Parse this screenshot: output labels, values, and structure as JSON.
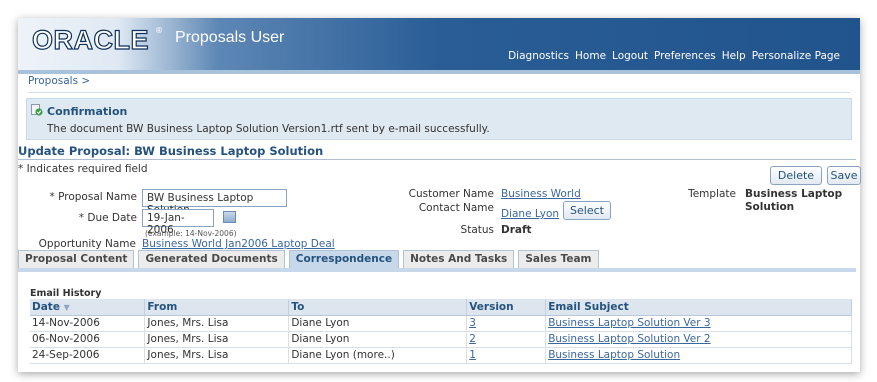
{
  "header": {
    "logo": "ORACLE",
    "logo_tm": "®",
    "app_title": "Proposals User",
    "global_links": [
      "Diagnostics",
      "Home",
      "Logout",
      "Preferences",
      "Help",
      "Personalize Page"
    ]
  },
  "breadcrumb": "Proposals  >",
  "confirmation": {
    "title": "Confirmation",
    "message": "The document BW Business Laptop Solution Version1.rtf sent by e-mail successfully."
  },
  "form": {
    "title": "Update Proposal: BW Business Laptop Solution",
    "required_note": "* Indicates required field",
    "delete_label": "Delete",
    "save_label": "Save",
    "proposal_name_label": "* Proposal Name",
    "proposal_name_value": "BW Business Laptop Solution",
    "due_date_label": "* Due Date",
    "due_date_value": "19-Jan-2006",
    "due_date_hint": "(example: 14-Nov-2006)",
    "opportunity_label": "Opportunity Name",
    "opportunity_value": "Business World Jan2006 Laptop Deal",
    "customer_label": "Customer Name",
    "customer_value": "Business World",
    "contact_label": "Contact Name",
    "contact_value": "Diane Lyon",
    "select_label": "Select",
    "status_label": "Status",
    "status_value": "Draft",
    "template_label": "Template",
    "template_value_1": "Business Laptop",
    "template_value_2": "Solution"
  },
  "tabs": [
    {
      "label": "Proposal Content"
    },
    {
      "label": "Generated Documents"
    },
    {
      "label": "Correspondence"
    },
    {
      "label": "Notes And Tasks"
    },
    {
      "label": "Sales Team"
    }
  ],
  "email_history": {
    "title": "Email History",
    "columns": [
      "Date",
      "From",
      "To",
      "Version",
      "Email Subject"
    ],
    "rows": [
      {
        "date": "14-Nov-2006",
        "from": "Jones, Mrs. Lisa",
        "to": "Diane Lyon",
        "version": "3",
        "subject": "Business Laptop Solution Ver 3"
      },
      {
        "date": "06-Nov-2006",
        "from": "Jones, Mrs. Lisa",
        "to": "Diane Lyon",
        "version": "2",
        "subject": "Business Laptop Solution Ver 2"
      },
      {
        "date": "24-Sep-2006",
        "from": "Jones, Mrs. Lisa",
        "to": "Diane Lyon (more..)",
        "version": "1",
        "subject": "Business Laptop Solution"
      }
    ]
  },
  "colors": {
    "brand_blue": "#21548d",
    "link": "#3b66a0",
    "section_title": "#25537f",
    "confirm_bg": "#dfe9f2",
    "active_tab": "#c7d8ea"
  },
  "icons": {
    "confirm": "confirmation-check-icon",
    "calendar": "calendar-icon",
    "sort": "sort-descending-icon"
  }
}
